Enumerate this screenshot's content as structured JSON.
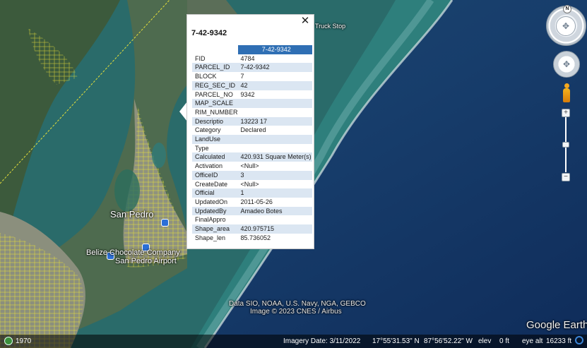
{
  "popup": {
    "title": "7-42-9342",
    "header_value": "7-42-9342",
    "close_glyph": "✕",
    "rows": [
      {
        "key": "FID",
        "value": "4784"
      },
      {
        "key": "PARCEL_ID",
        "value": "7-42-9342"
      },
      {
        "key": "BLOCK",
        "value": "7"
      },
      {
        "key": "REG_SEC_ID",
        "value": "42"
      },
      {
        "key": "PARCEL_NO",
        "value": "9342"
      },
      {
        "key": "MAP_SCALE",
        "value": ""
      },
      {
        "key": "RIM_NUMBER",
        "value": ""
      },
      {
        "key": "Descriptio",
        "value": "13223 17"
      },
      {
        "key": "Category",
        "value": "Declared"
      },
      {
        "key": "LandUse",
        "value": ""
      },
      {
        "key": "Type",
        "value": ""
      },
      {
        "key": "Calculated",
        "value": "420.931 Square Meter(s)"
      },
      {
        "key": "Activation",
        "value": "<Null>"
      },
      {
        "key": "OfficeID",
        "value": "3"
      },
      {
        "key": "CreateDate",
        "value": "<Null>"
      },
      {
        "key": "Official",
        "value": "1"
      },
      {
        "key": "UpdatedOn",
        "value": "2011-05-26"
      },
      {
        "key": "UpdatedBy",
        "value": "Amadeo Botes"
      },
      {
        "key": "FinalAppro",
        "value": ""
      },
      {
        "key": "Shape_area",
        "value": "420.975715"
      },
      {
        "key": "Shape_len",
        "value": "85.736052"
      }
    ]
  },
  "map": {
    "labels": {
      "town": "San Pedro",
      "chocolate": "Belize Chocolate Company",
      "airport": "San Pedro Airport",
      "truck_stop": "Truck Stop",
      "credit_line1": "Data SIO, NOAA, U.S. Navy, NGA, GEBCO",
      "credit_line2": "Image © 2023 CNES / Airbus",
      "logo": "Google Earth"
    }
  },
  "navigation": {
    "compass_letter": "N",
    "compass_center_glyph": "✥",
    "look_glyph": "✥",
    "zoom_in": "+",
    "zoom_out": "−"
  },
  "status_bar": {
    "history_year": "1970",
    "imagery_date": "Imagery Date: 3/11/2022",
    "latitude": "17°55'31.53\" N",
    "longitude": "87°56'52.22\" W",
    "elev_label": "elev",
    "elev_value": "0 ft",
    "eye_alt_label": "eye alt",
    "eye_alt_value": "16233 ft"
  },
  "colors": {
    "popup_header": "#2f6fb4",
    "popup_stripe": "#dbe6f2",
    "parcel_lines": "#e6e03a",
    "deep_water": "#0d2a52",
    "shallow_water": "#2f8a86"
  }
}
